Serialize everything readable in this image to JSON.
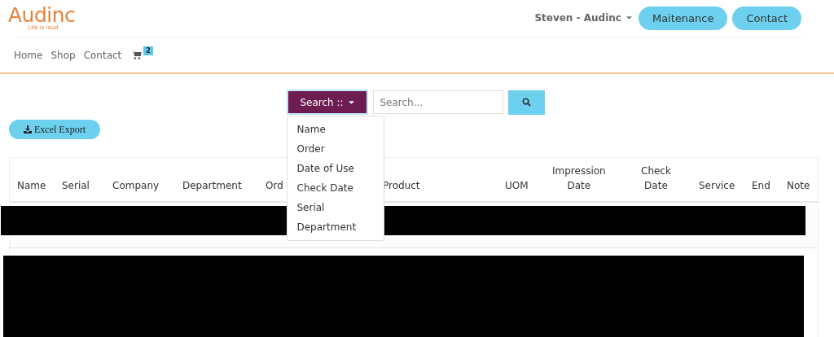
{
  "logo": {
    "name": "Audinc",
    "tagline": "Life is loud"
  },
  "user_menu": {
    "label": "Steven - Audinc"
  },
  "header_buttons": [
    "Maitenance",
    "Contact"
  ],
  "nav": {
    "items": [
      "Home",
      "Shop",
      "Contact"
    ],
    "cart_count": "2"
  },
  "search": {
    "button": "Search ::",
    "placeholder": "Search...",
    "dropdown_expanded": true,
    "options": [
      "Name",
      "Order",
      "Date of Use",
      "Check Date",
      "Serial",
      "Department"
    ]
  },
  "export_button": "Excel Export",
  "table": {
    "columns": [
      [
        "Name"
      ],
      [
        "Serial"
      ],
      [
        "Company"
      ],
      [
        "Department"
      ],
      [
        "Ord"
      ],
      [],
      [
        "Product"
      ],
      [
        "UOM"
      ],
      [
        "Impression",
        "Date"
      ],
      [
        "Check",
        "Date"
      ],
      [
        "Service"
      ],
      [
        "End"
      ],
      [
        "Note"
      ]
    ],
    "rows": [
      {
        "kind": "redacted"
      },
      {
        "kind": "redacted"
      }
    ]
  }
}
